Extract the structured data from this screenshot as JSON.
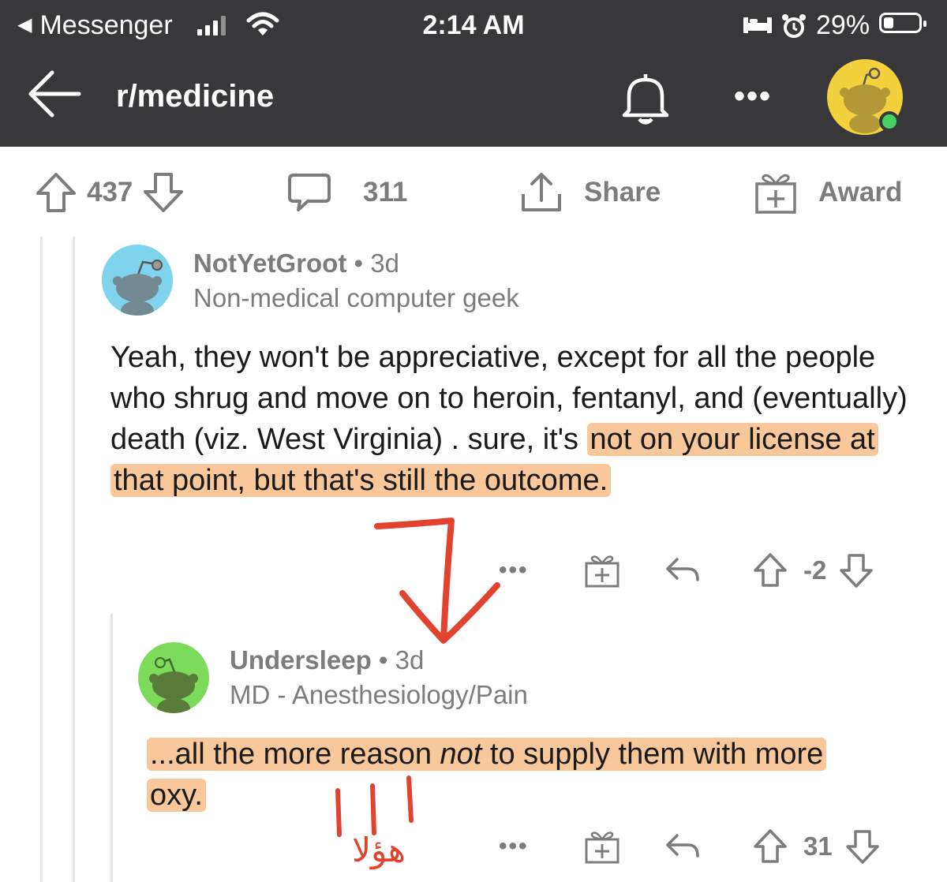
{
  "status_bar": {
    "back_app": "Messenger",
    "time": "2:14 AM",
    "battery": "29%"
  },
  "header": {
    "title": "r/medicine"
  },
  "post_actions": {
    "score": "437",
    "comments": "311",
    "share": "Share",
    "award": "Award"
  },
  "comments": [
    {
      "username": "NotYetGroot",
      "age": "3d",
      "separator": "•",
      "flair": "Non-medical computer geek",
      "body_plain": "Yeah, they won't be appreciative, except for all the people who shrug and move on to heroin, fentanyl, and (eventually) death (viz. West Virginia) .  sure, it's ",
      "body_highlight": "not on your license at that point, but that's still the outcome.",
      "score": "-2",
      "more": "•••"
    },
    {
      "username": "Undersleep",
      "age": "3d",
      "separator": "•",
      "flair": "MD - Anesthesiology/Pain",
      "body_part1": "...all the more reason ",
      "body_italic": "not",
      "body_part2": " to supply them with more oxy.",
      "score": "31",
      "more": "•••"
    }
  ],
  "annotation": {
    "arabic_scribble": "هؤلا",
    "arrow_color": "#e2432e",
    "highlight_color": "#f5b478"
  },
  "colors": {
    "header_bg": "#38383a",
    "muted_text": "#7c7c7c",
    "avatar_groot_bg": "#7fd3ec",
    "avatar_undersleep_bg": "#7ddb5c",
    "avatar_self_bg": "#f2d13c",
    "online_dot": "#46d160"
  }
}
